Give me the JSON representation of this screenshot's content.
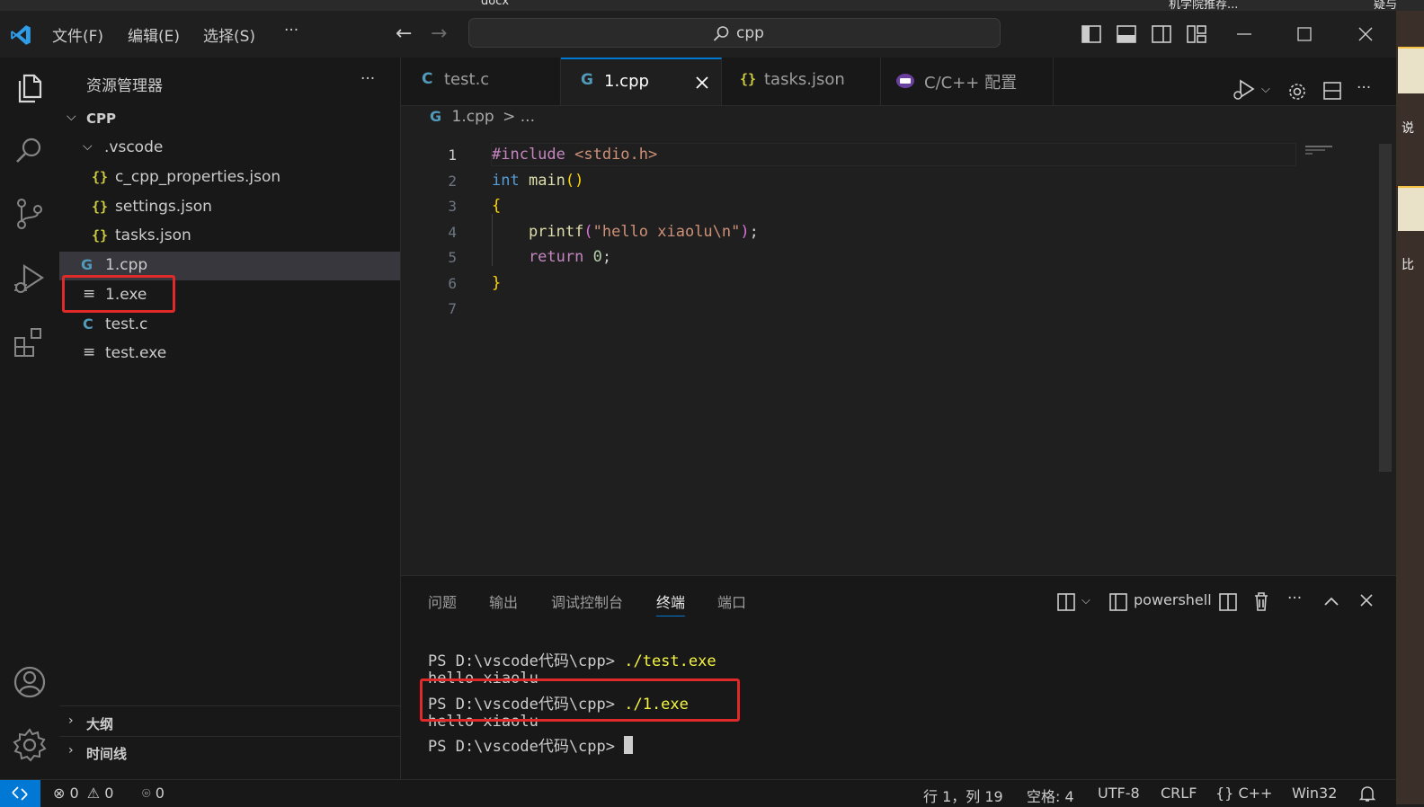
{
  "desktop": {
    "top_texts": [
      "docx",
      "机学院推荐...",
      "疑与"
    ],
    "right_texts": [
      "说",
      "比"
    ]
  },
  "titlebar": {
    "menu": [
      "文件(F)",
      "编辑(E)",
      "选择(S)"
    ],
    "more": "···",
    "search_text": "cpp"
  },
  "sidebar": {
    "title": "资源管理器",
    "more": "···",
    "root": "CPP",
    "vscode_folder": ".vscode",
    "vscode_files": [
      "c_cpp_properties.json",
      "settings.json",
      "tasks.json"
    ],
    "files": [
      "1.cpp",
      "1.exe",
      "test.c",
      "test.exe"
    ],
    "outline": "大纲",
    "timeline": "时间线"
  },
  "tabs": [
    {
      "label": "test.c"
    },
    {
      "label": "1.cpp"
    },
    {
      "label": "tasks.json"
    },
    {
      "label": "C/C++ 配置"
    }
  ],
  "breadcrumb": {
    "file": "1.cpp",
    "rest": "> ..."
  },
  "editor": {
    "line_numbers": [
      "1",
      "2",
      "3",
      "4",
      "5",
      "6",
      "7"
    ],
    "code": {
      "l1a": "#include",
      "l1b": " <stdio.h>",
      "l2a": "int",
      "l2b": " main",
      "l2c": "()",
      "l3": "{",
      "l4a": "    printf",
      "l4b": "(",
      "l4c": "\"hello xiaolu\\n\"",
      "l4d": ")",
      "l4e": ";",
      "l5a": "    return",
      "l5b": " 0",
      "l5c": ";",
      "l6": "}"
    }
  },
  "panel": {
    "tabs": [
      "问题",
      "输出",
      "调试控制台",
      "终端",
      "端口"
    ],
    "shell": "powershell",
    "more": "···",
    "terminal": {
      "prompt": "PS D:\\vscode代码\\cpp> ",
      "cmd1": "./test.exe",
      "out1": "hello xiaolu",
      "cmd2": "./1.exe",
      "out2": "hello xiaolu"
    }
  },
  "statusbar": {
    "errors": "0",
    "warnings": "0",
    "ports": "0",
    "position": "行 1，列 19",
    "spaces": "空格: 4",
    "encoding": "UTF-8",
    "eol": "CRLF",
    "language": "C++",
    "platform": "Win32"
  },
  "colors": {
    "accent": "#0078d4",
    "highlight_box": "#e02a2a"
  }
}
